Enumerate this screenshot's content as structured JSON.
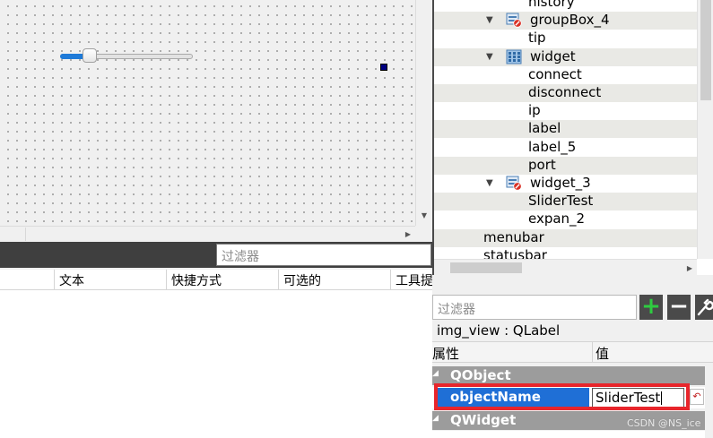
{
  "form_canvas": {
    "slider_value_fraction": 0.2
  },
  "action_editor": {
    "filter_placeholder": "过滤器",
    "columns": [
      "",
      "文本",
      "快捷方式",
      "可选的",
      "工具提"
    ]
  },
  "object_inspector": {
    "rows": [
      {
        "label": "history",
        "indent": 1,
        "icon": "",
        "expander": ""
      },
      {
        "label": "groupBox_4",
        "indent": 0,
        "icon": "groupbox-icon",
        "expander": "expanded"
      },
      {
        "label": "tip",
        "indent": 1,
        "icon": "",
        "expander": ""
      },
      {
        "label": "widget",
        "indent": 0,
        "icon": "grid-layout-icon",
        "expander": "expanded"
      },
      {
        "label": "connect",
        "indent": 1,
        "icon": "",
        "expander": ""
      },
      {
        "label": "disconnect",
        "indent": 1,
        "icon": "",
        "expander": ""
      },
      {
        "label": "ip",
        "indent": 1,
        "icon": "",
        "expander": ""
      },
      {
        "label": "label",
        "indent": 1,
        "icon": "",
        "expander": ""
      },
      {
        "label": "label_5",
        "indent": 1,
        "icon": "",
        "expander": ""
      },
      {
        "label": "port",
        "indent": 1,
        "icon": "",
        "expander": ""
      },
      {
        "label": "widget_3",
        "indent": 0,
        "icon": "groupbox-icon",
        "expander": "expanded"
      },
      {
        "label": "SliderTest",
        "indent": 1,
        "icon": "",
        "expander": ""
      },
      {
        "label": "expan_2",
        "indent": 1,
        "icon": "",
        "expander": ""
      },
      {
        "label": "menubar",
        "indent": -1,
        "icon": "",
        "expander": ""
      },
      {
        "label": "statusbar",
        "indent": -1,
        "icon": "",
        "expander": ""
      }
    ]
  },
  "property_editor": {
    "filter_placeholder": "过滤器",
    "add_icon": "plus-icon",
    "remove_icon": "minus-icon",
    "config_icon": "wrench-icon",
    "object_class": "img_view : QLabel",
    "header_property": "属性",
    "header_value": "值",
    "group_qobject": "QObject",
    "group_qwidget": "QWidget",
    "object_name_label": "objectName",
    "object_name_value": "SliderTest",
    "reset_icon": "reset-arrow-icon"
  },
  "watermark": "CSDN @NS_ice",
  "colors": {
    "selection": "#1f6fd6",
    "highlight_box": "#e8252b",
    "group_header": "#9c9c9c",
    "add_green": "#2ecc40"
  }
}
